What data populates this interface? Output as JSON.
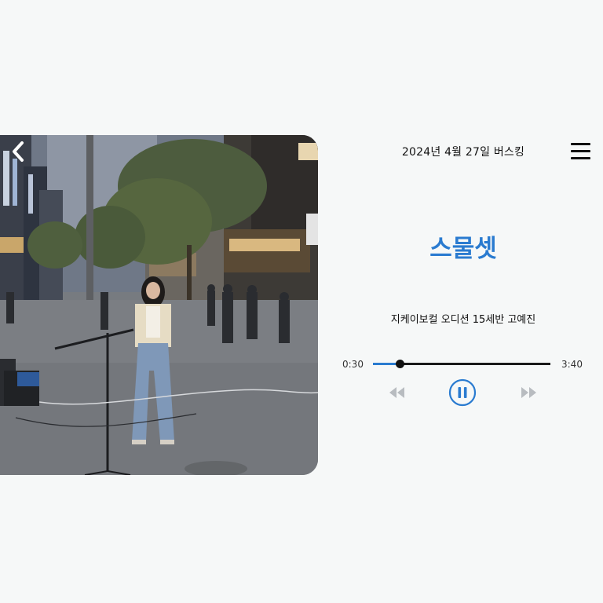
{
  "header": {
    "title": "2024년 4월 27일 버스킹",
    "back_icon": "chevron-left-icon",
    "menu_icon": "hamburger-menu-icon"
  },
  "track": {
    "title": "스물셋",
    "subtitle": "지케이보컬 오디션 15세반 고예진"
  },
  "player": {
    "current_time": "0:30",
    "total_time": "3:40",
    "progress": 0.15,
    "controls": [
      "rewind-icon",
      "pause-icon",
      "fast-forward-icon"
    ]
  },
  "colors": {
    "accent": "#2a7bd0",
    "background": "#f6f8f8",
    "text": "#111111",
    "control_inactive": "#b8bcc0"
  }
}
